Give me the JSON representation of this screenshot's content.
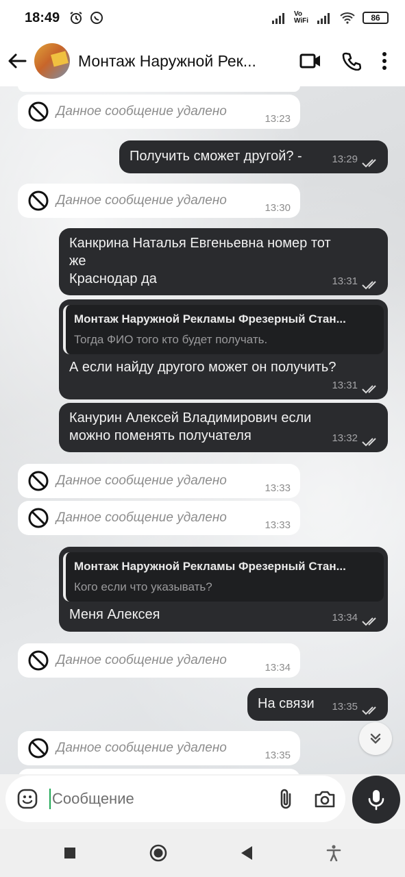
{
  "status_bar": {
    "time": "18:49",
    "network_label": "Vo WiFi",
    "battery": "86"
  },
  "header": {
    "title": "Монтаж Наружной Рек...",
    "icons": [
      "back-arrow-icon",
      "video-call-icon",
      "phone-icon",
      "more-icon"
    ]
  },
  "messages": [
    {
      "type": "deleted",
      "text": "Данное сообщение удалено",
      "time": "13:23"
    },
    {
      "type": "out",
      "text": "Получить сможет другой? -",
      "time": "13:29"
    },
    {
      "type": "deleted",
      "text": "Данное сообщение удалено",
      "time": "13:30"
    },
    {
      "type": "out",
      "lines": [
        "Канкрина Наталья Евгеньевна номер тот",
        "же",
        "Краснодар да"
      ],
      "time": "13:31"
    },
    {
      "type": "out_reply",
      "quote_name": "Монтаж Наружной Рекламы Фрезерный Стан...",
      "quote_text": "Тогда ФИО того кто будет получать.",
      "text": "А если найду другого может он получить?",
      "time": "13:31"
    },
    {
      "type": "out",
      "lines": [
        "Канурин Алексей Владимирович если",
        "можно поменять получателя"
      ],
      "time": "13:32"
    },
    {
      "type": "deleted",
      "text": "Данное сообщение удалено",
      "time": "13:33"
    },
    {
      "type": "deleted",
      "text": "Данное сообщение удалено",
      "time": "13:33"
    },
    {
      "type": "out_reply",
      "quote_name": "Монтаж Наружной Рекламы Фрезерный Стан...",
      "quote_text": "Кого если что указывать?",
      "text": "Меня Алексея",
      "time": "13:34"
    },
    {
      "type": "deleted",
      "text": "Данное сообщение удалено",
      "time": "13:34"
    },
    {
      "type": "out",
      "text": "На связи",
      "time": "13:35"
    },
    {
      "type": "deleted",
      "text": "Данное сообщение удалено",
      "time": "13:35"
    }
  ],
  "composer": {
    "placeholder": "Сообщение"
  }
}
